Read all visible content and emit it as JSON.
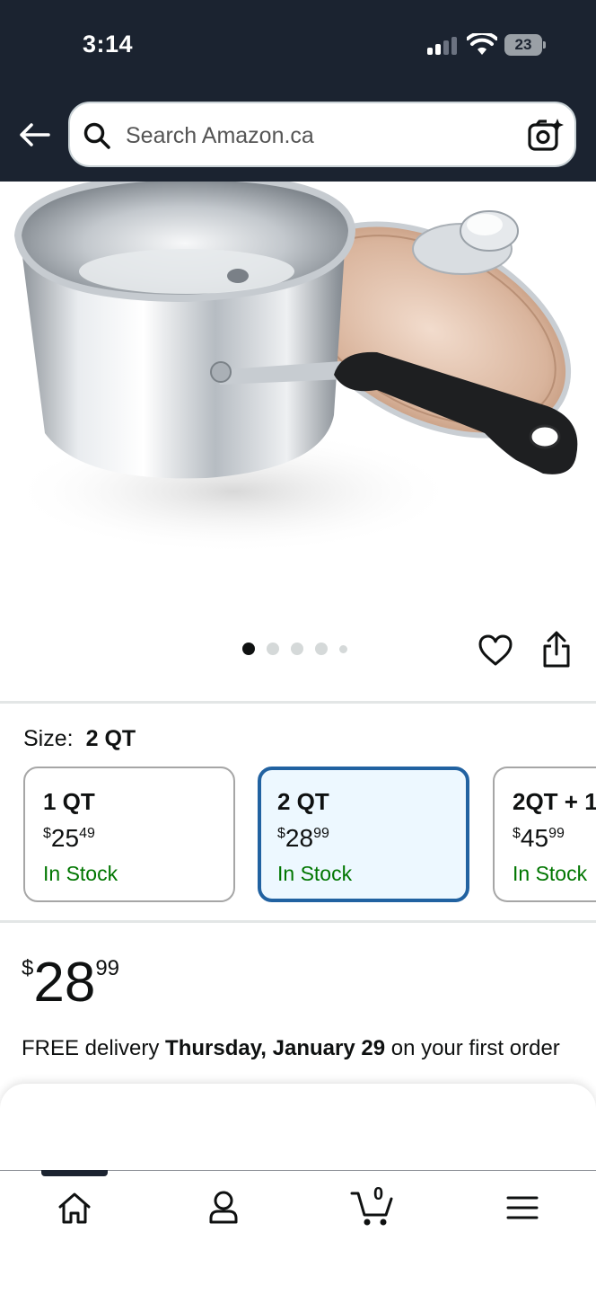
{
  "status_bar": {
    "time": "3:14",
    "battery": "23"
  },
  "search": {
    "placeholder": "Search Amazon.ca"
  },
  "carousel": {
    "total_dots": 5,
    "active_index": 0
  },
  "size": {
    "label": "Size:",
    "selected": "2 QT",
    "options": [
      {
        "name": "1 QT",
        "currency": "$",
        "whole": "25",
        "fraction": "49",
        "stock": "In Stock"
      },
      {
        "name": "2 QT",
        "currency": "$",
        "whole": "28",
        "fraction": "99",
        "stock": "In Stock"
      },
      {
        "name": "2QT + 1",
        "currency": "$",
        "whole": "45",
        "fraction": "99",
        "stock": "In Stock"
      }
    ]
  },
  "price": {
    "currency": "$",
    "whole": "28",
    "fraction": "99"
  },
  "delivery": {
    "prefix": "FREE delivery ",
    "date": "Thursday, January 29",
    "suffix": " on your first order"
  },
  "nav": {
    "cart_count": "0"
  },
  "colors": {
    "header_bg": "#1b2330",
    "selected_border": "#2162a1",
    "selected_bg": "#edf8ff",
    "in_stock": "#007600"
  }
}
